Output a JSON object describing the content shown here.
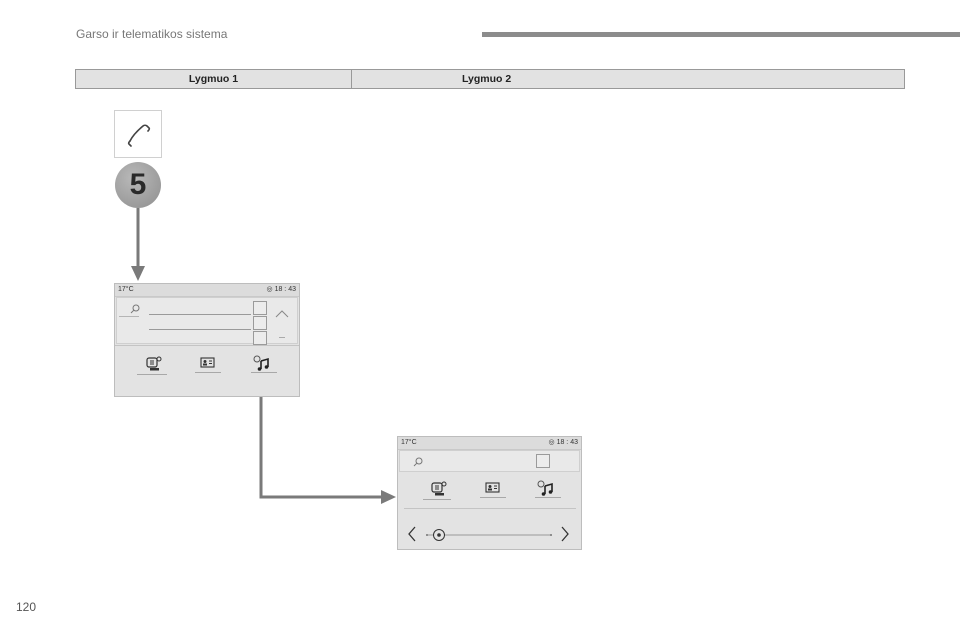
{
  "header": {
    "title": "Garso ir telematikos sistema"
  },
  "level_table": {
    "level1": "Lygmuo 1",
    "level2": "Lygmuo 2"
  },
  "step_number": "5",
  "screen1": {
    "temperature": "17°C",
    "time": "18 : 43"
  },
  "screen2": {
    "temperature": "17°C",
    "time": "18 : 43"
  },
  "icons": {
    "phone": "phone-icon",
    "search": "search-icon",
    "radio": "radio-icon",
    "contacts": "contacts-icon",
    "music": "music-icon",
    "clock": "clock-icon",
    "arrow_up": "chevron-up-icon",
    "arrow_left": "chevron-left-icon",
    "arrow_right": "chevron-right-icon",
    "slider_knob": "slider-knob-icon"
  },
  "colors": {
    "accent_bar": "#8c8c8c",
    "screen_bg": "#e3e3e3",
    "step_circle": "#9a9a9a"
  },
  "page_number": "120"
}
